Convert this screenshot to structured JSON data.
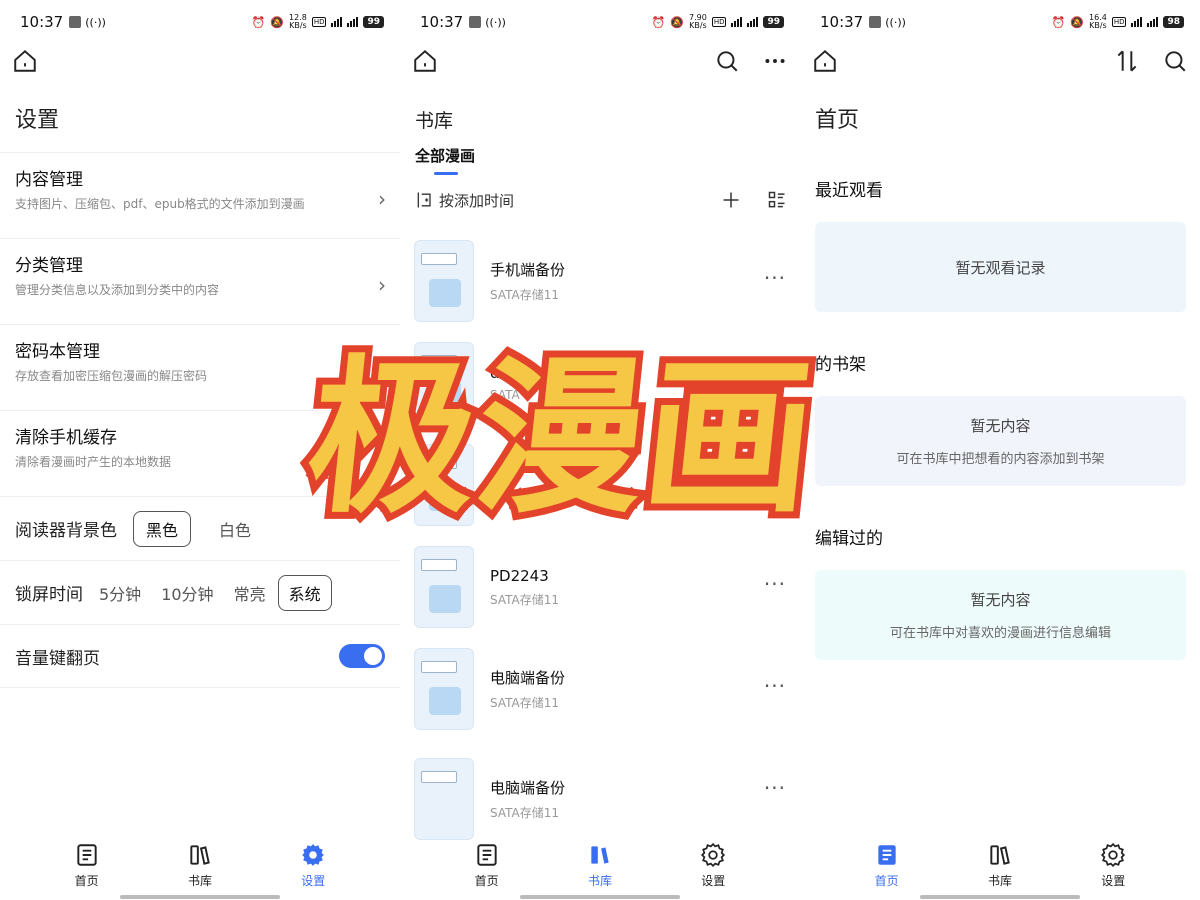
{
  "status_bars": [
    {
      "time": "10:37",
      "speed": "12.8",
      "speed_unit": "KB/s",
      "battery": "99"
    },
    {
      "time": "10:37",
      "speed": "7.90",
      "speed_unit": "KB/s",
      "battery": "99"
    },
    {
      "time": "10:37",
      "speed": "16.4",
      "speed_unit": "KB/s",
      "battery": "98"
    }
  ],
  "settings": {
    "title": "设置",
    "items": [
      {
        "title": "内容管理",
        "subtitle": "支持图片、压缩包、pdf、epub格式的文件添加到漫画"
      },
      {
        "title": "分类管理",
        "subtitle": "管理分类信息以及添加到分类中的内容"
      },
      {
        "title": "密码本管理",
        "subtitle": "存放查看加密压缩包漫画的解压密码"
      },
      {
        "title": "清除手机缓存",
        "subtitle": "清除看漫画时产生的本地数据"
      }
    ],
    "reader_bg": {
      "label": "阅读器背景色",
      "options": [
        "黑色",
        "白色"
      ],
      "selected": "黑色"
    },
    "lock_time": {
      "label": "锁屏时间",
      "options": [
        "5分钟",
        "10分钟",
        "常亮",
        "系统"
      ],
      "selected": "系统"
    },
    "volume_key": {
      "label": "音量键翻页",
      "enabled": true
    }
  },
  "library": {
    "title": "书库",
    "tab": "全部漫画",
    "sort_label": "按添加时间",
    "books": [
      {
        "name": "手机端备份",
        "sub": "SATA存储11"
      },
      {
        "name": "de",
        "sub": "SATA"
      },
      {
        "name": "",
        "sub": ""
      },
      {
        "name": "PD2243",
        "sub": "SATA存储11"
      },
      {
        "name": "电脑端备份",
        "sub": "SATA存储11"
      },
      {
        "name": "电脑端备份",
        "sub": "SATA存储11"
      }
    ]
  },
  "home": {
    "title": "首页",
    "recent": {
      "title": "最近观看",
      "empty": "暂无观看记录"
    },
    "shelf": {
      "title": "的书架",
      "empty": "暂无内容",
      "hint": "可在书库中把想看的内容添加到书架"
    },
    "edited": {
      "title": "编辑过的",
      "empty": "暂无内容",
      "hint": "可在书库中对喜欢的漫画进行信息编辑"
    }
  },
  "nav": {
    "home": "首页",
    "library": "书库",
    "settings": "设置"
  },
  "banner_text": "极漫画",
  "colors": {
    "accent": "#3a6ef0",
    "banner_fill": "#f6c744",
    "banner_stroke": "#e2432a"
  }
}
